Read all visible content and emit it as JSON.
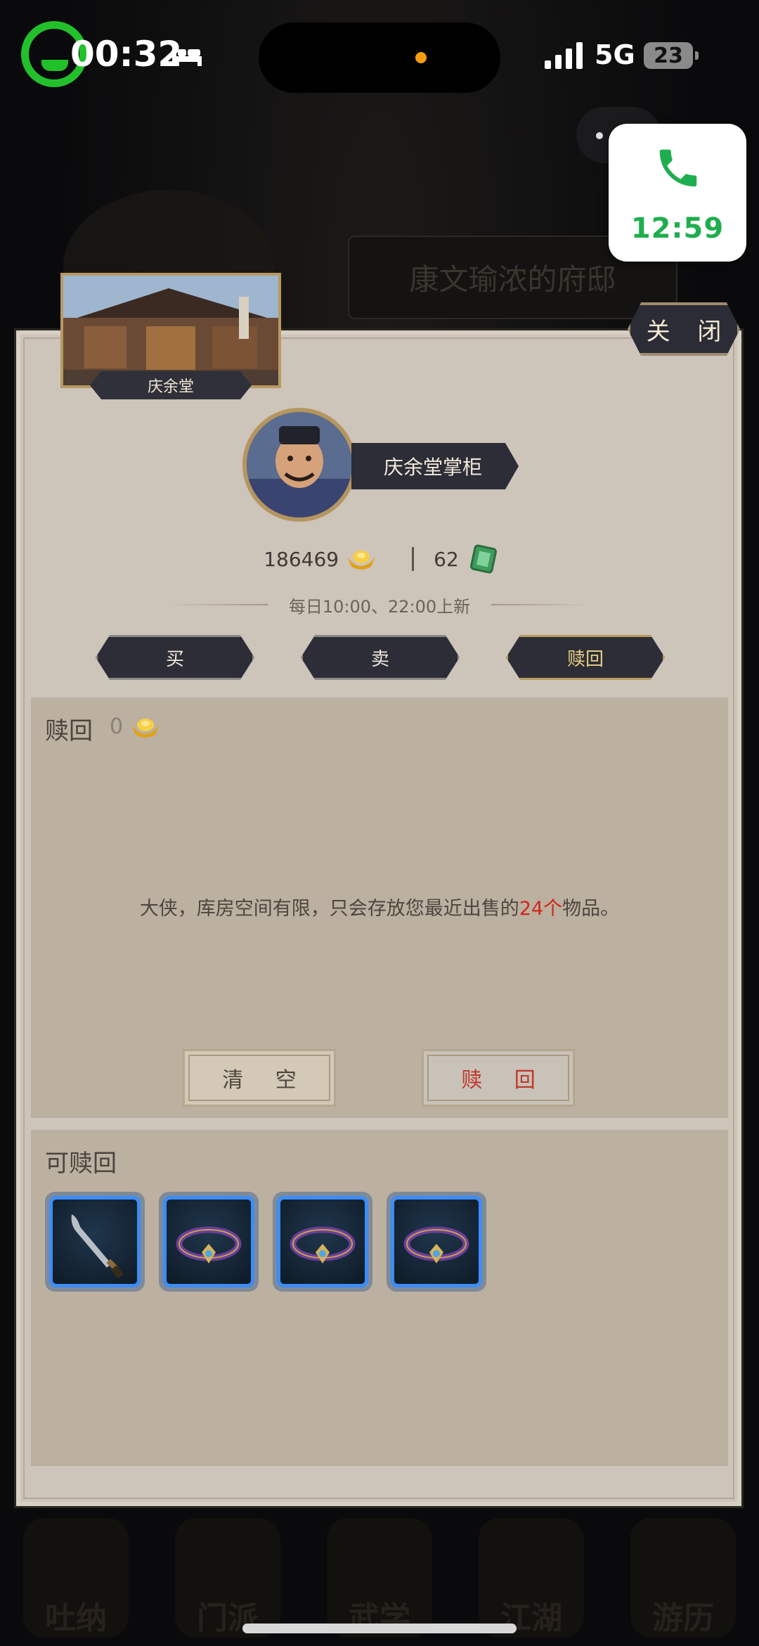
{
  "status_bar": {
    "time": "00:32",
    "network": "5G",
    "battery": "23"
  },
  "call_widget": {
    "time": "12:59"
  },
  "background": {
    "estate_title": "康文瑜浓的府邸",
    "nav": [
      "吐纳",
      "门派",
      "武学",
      "江湖",
      "游历"
    ]
  },
  "panel": {
    "close_label": "关 闭",
    "shop_name": "庆余堂",
    "npc_name": "庆余堂掌柜",
    "gold": "186469",
    "tickets": "62",
    "refresh_text": "每日10:00、22:00上新",
    "tabs": [
      {
        "label": "买"
      },
      {
        "label": "卖"
      },
      {
        "label": "赎回",
        "active": true
      }
    ],
    "buyback": {
      "title": "赎回",
      "cost": "0",
      "notice_prefix": "大侠，库房空间有限，只会存放您最近出售的",
      "notice_highlight": "24个",
      "notice_suffix": "物品。",
      "clear_label": "清 空",
      "redeem_label": "赎 回"
    },
    "redeemable": {
      "title": "可赎回",
      "items": [
        "saber-item-icon",
        "headband-item-icon",
        "headband-item-icon",
        "headband-item-icon"
      ]
    }
  },
  "colors": {
    "accent_red": "#d2251f",
    "item_border_blue": "#3c8df5",
    "call_green": "#1fae4f",
    "record_green": "#22c12b"
  }
}
